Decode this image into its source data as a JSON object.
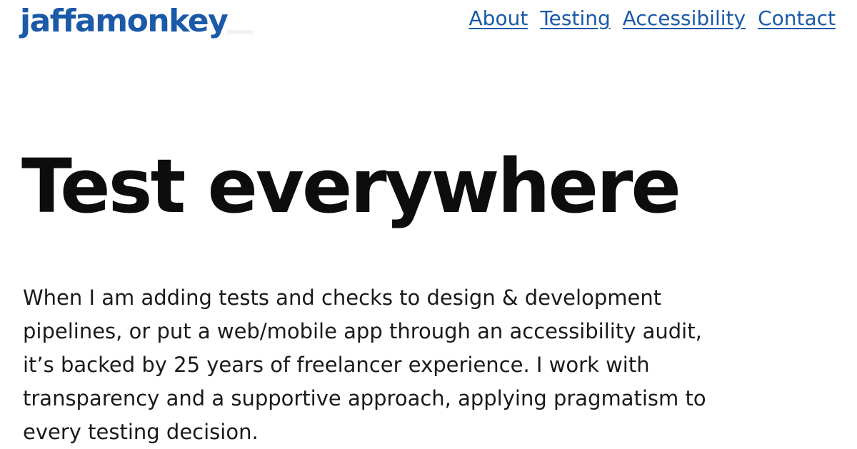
{
  "header": {
    "logo_text": "jaffamonkey",
    "nav": [
      {
        "label": "About"
      },
      {
        "label": "Testing"
      },
      {
        "label": "Accessibility"
      },
      {
        "label": "Contact"
      }
    ]
  },
  "hero": {
    "title": "Test everywhere",
    "body": "When I am adding tests and checks to design & development pipelines, or put a web/mobile app through an accessibility audit, it’s backed by 25 years of freelancer experience. I work with transparency and a supportive approach, applying pragmatism to every testing decision."
  },
  "colors": {
    "brand": "#1b5aa8",
    "text": "#111111",
    "background": "#ffffff"
  }
}
